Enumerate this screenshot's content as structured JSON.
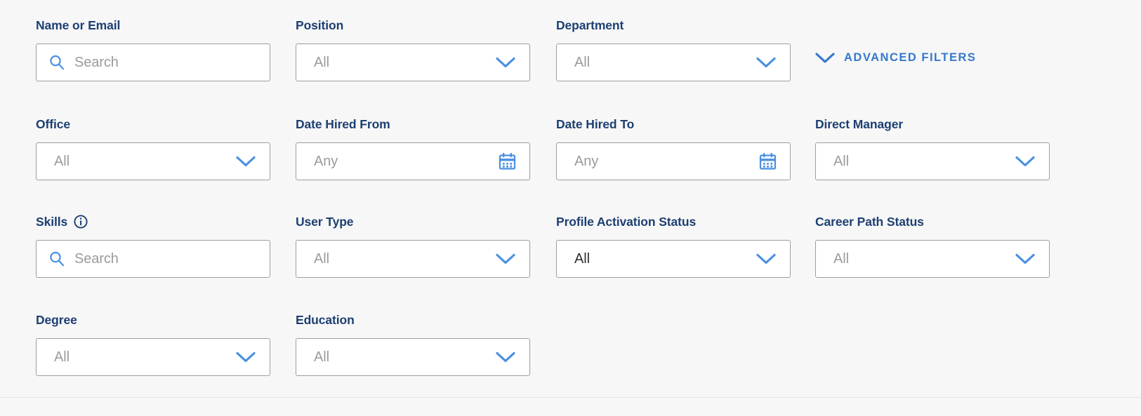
{
  "colors": {
    "background": "#f7f7f7",
    "label": "#1d3f72",
    "accent_blue": "#4a90e2",
    "link_blue": "#3478cd",
    "field_border": "#9d9d9d",
    "placeholder": "#9b9b9b",
    "value_text": "#2f2f2f"
  },
  "advanced_filters": {
    "label": "ADVANCED FILTERS",
    "chevron_icon": "chevron-down-icon"
  },
  "fields": [
    {
      "id": "name-or-email",
      "label": "Name or Email",
      "type": "search",
      "placeholder": "Search",
      "value": "",
      "icon": "search-icon",
      "col": 1,
      "row": 1,
      "has_info": false
    },
    {
      "id": "position",
      "label": "Position",
      "type": "select",
      "placeholder": "All",
      "value": "",
      "icon": "chevron-down-icon",
      "col": 2,
      "row": 1,
      "has_info": false
    },
    {
      "id": "department",
      "label": "Department",
      "type": "select",
      "placeholder": "All",
      "value": "",
      "icon": "chevron-down-icon",
      "col": 3,
      "row": 1,
      "has_info": false
    },
    {
      "id": "office",
      "label": "Office",
      "type": "select",
      "placeholder": "All",
      "value": "",
      "icon": "chevron-down-icon",
      "col": 1,
      "row": 2,
      "has_info": false
    },
    {
      "id": "date-hired-from",
      "label": "Date Hired From",
      "type": "date",
      "placeholder": "Any",
      "value": "",
      "icon": "calendar-icon",
      "col": 2,
      "row": 2,
      "has_info": false
    },
    {
      "id": "date-hired-to",
      "label": "Date Hired To",
      "type": "date",
      "placeholder": "Any",
      "value": "",
      "icon": "calendar-icon",
      "col": 3,
      "row": 2,
      "has_info": false
    },
    {
      "id": "direct-manager",
      "label": "Direct Manager",
      "type": "select",
      "placeholder": "All",
      "value": "",
      "icon": "chevron-down-icon",
      "col": 4,
      "row": 2,
      "has_info": false
    },
    {
      "id": "skills",
      "label": "Skills",
      "type": "search",
      "placeholder": "Search",
      "value": "",
      "icon": "search-icon",
      "col": 1,
      "row": 3,
      "has_info": true,
      "info_icon": "info-icon"
    },
    {
      "id": "user-type",
      "label": "User Type",
      "type": "select",
      "placeholder": "All",
      "value": "",
      "icon": "chevron-down-icon",
      "col": 2,
      "row": 3,
      "has_info": false
    },
    {
      "id": "profile-activation-status",
      "label": "Profile Activation Status",
      "type": "select",
      "placeholder": "All",
      "value": "All",
      "icon": "chevron-down-icon",
      "col": 3,
      "row": 3,
      "has_info": false
    },
    {
      "id": "career-path-status",
      "label": "Career Path Status",
      "type": "select",
      "placeholder": "All",
      "value": "",
      "icon": "chevron-down-icon",
      "col": 4,
      "row": 3,
      "has_info": false
    },
    {
      "id": "degree",
      "label": "Degree",
      "type": "select",
      "placeholder": "All",
      "value": "",
      "icon": "chevron-down-icon",
      "col": 1,
      "row": 4,
      "has_info": false
    },
    {
      "id": "education",
      "label": "Education",
      "type": "select",
      "placeholder": "All",
      "value": "",
      "icon": "chevron-down-icon",
      "col": 2,
      "row": 4,
      "has_info": false
    }
  ]
}
